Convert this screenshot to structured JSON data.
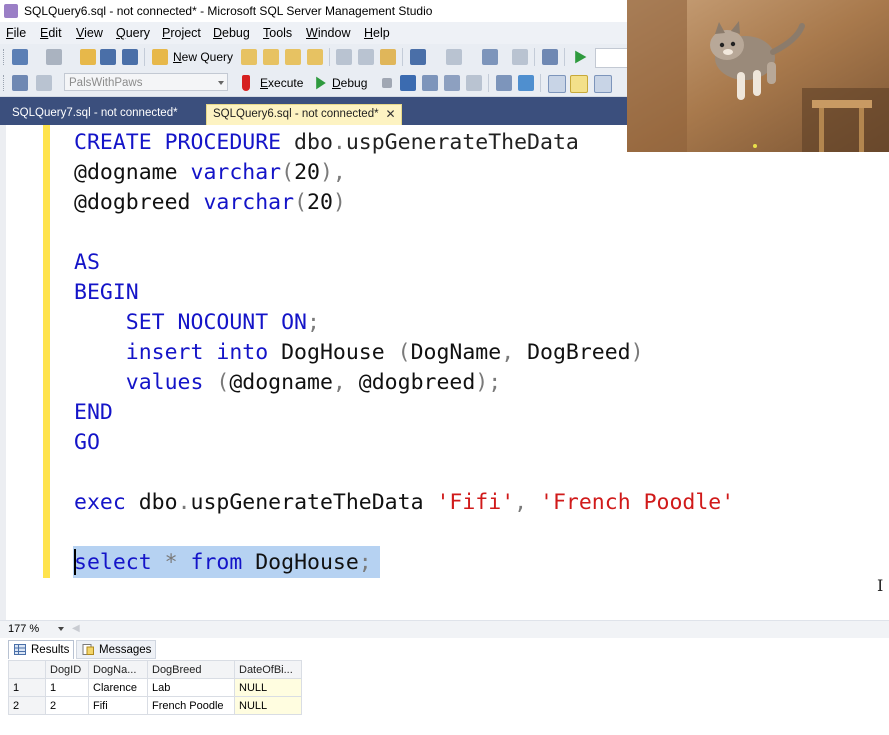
{
  "window": {
    "title": "SQLQuery6.sql - not connected* - Microsoft SQL Server Management Studio"
  },
  "menu": [
    "File",
    "Edit",
    "View",
    "Query",
    "Project",
    "Debug",
    "Tools",
    "Window",
    "Help"
  ],
  "toolbar1": {
    "new_query_label": "New Query"
  },
  "toolbar2": {
    "database": "PalsWithPaws",
    "execute_label": "Execute",
    "debug_label": "Debug"
  },
  "tabs": [
    {
      "label": "SQLQuery7.sql - not connected*",
      "active": false
    },
    {
      "label": "SQLQuery6.sql - not connected*",
      "active": true
    }
  ],
  "editor": {
    "lines": [
      [
        {
          "t": "CREATE PROCEDURE",
          "c": "kw"
        },
        {
          "t": " dbo",
          "c": "fn"
        },
        {
          "t": ".",
          "c": "gray"
        },
        {
          "t": "uspGenerateTheData",
          "c": "fn"
        }
      ],
      [
        {
          "t": "@dogname ",
          "c": "plain"
        },
        {
          "t": "varchar",
          "c": "kw"
        },
        {
          "t": "(",
          "c": "gray"
        },
        {
          "t": "20",
          "c": "plain"
        },
        {
          "t": "),",
          "c": "gray"
        }
      ],
      [
        {
          "t": "@dogbreed ",
          "c": "plain"
        },
        {
          "t": "varchar",
          "c": "kw"
        },
        {
          "t": "(",
          "c": "gray"
        },
        {
          "t": "20",
          "c": "plain"
        },
        {
          "t": ")",
          "c": "gray"
        }
      ],
      [],
      [
        {
          "t": "AS",
          "c": "kw"
        }
      ],
      [
        {
          "t": "BEGIN",
          "c": "kw"
        }
      ],
      [
        {
          "t": "    SET NOCOUNT ON",
          "c": "kw"
        },
        {
          "t": ";",
          "c": "gray"
        }
      ],
      [
        {
          "t": "    insert into",
          "c": "kw"
        },
        {
          "t": " DogHouse ",
          "c": "plain"
        },
        {
          "t": "(",
          "c": "gray"
        },
        {
          "t": "DogName",
          "c": "plain"
        },
        {
          "t": ", ",
          "c": "gray"
        },
        {
          "t": "DogBreed",
          "c": "plain"
        },
        {
          "t": ")",
          "c": "gray"
        }
      ],
      [
        {
          "t": "    values",
          "c": "kw"
        },
        {
          "t": " (",
          "c": "gray"
        },
        {
          "t": "@dogname",
          "c": "plain"
        },
        {
          "t": ", ",
          "c": "gray"
        },
        {
          "t": "@dogbreed",
          "c": "plain"
        },
        {
          "t": ");",
          "c": "gray"
        }
      ],
      [
        {
          "t": "END",
          "c": "kw"
        }
      ],
      [
        {
          "t": "GO",
          "c": "kw"
        }
      ],
      [],
      [
        {
          "t": "exec",
          "c": "kw"
        },
        {
          "t": " dbo",
          "c": "plain"
        },
        {
          "t": ".",
          "c": "gray"
        },
        {
          "t": "uspGenerateTheData ",
          "c": "plain"
        },
        {
          "t": "'Fifi'",
          "c": "str"
        },
        {
          "t": ", ",
          "c": "gray"
        },
        {
          "t": "'French Poodle'",
          "c": "str"
        }
      ],
      [],
      [
        {
          "t": "select",
          "c": "kw"
        },
        {
          "t": " * ",
          "c": "gray"
        },
        {
          "t": "from",
          "c": "kw"
        },
        {
          "t": " DogHouse",
          "c": "plain"
        },
        {
          "t": ";",
          "c": "gray"
        }
      ]
    ]
  },
  "zoom": "177 %",
  "results_tabs": {
    "results_label": "Results",
    "messages_label": "Messages"
  },
  "results": {
    "columns": [
      "DogID",
      "DogNa...",
      "DogBreed",
      "DateOfBi..."
    ],
    "rows": [
      {
        "num": "1",
        "cells": [
          "1",
          "Clarence",
          "Lab",
          "NULL"
        ]
      },
      {
        "num": "2",
        "cells": [
          "2",
          "Fifi",
          "French Poodle",
          "NULL"
        ]
      }
    ]
  }
}
